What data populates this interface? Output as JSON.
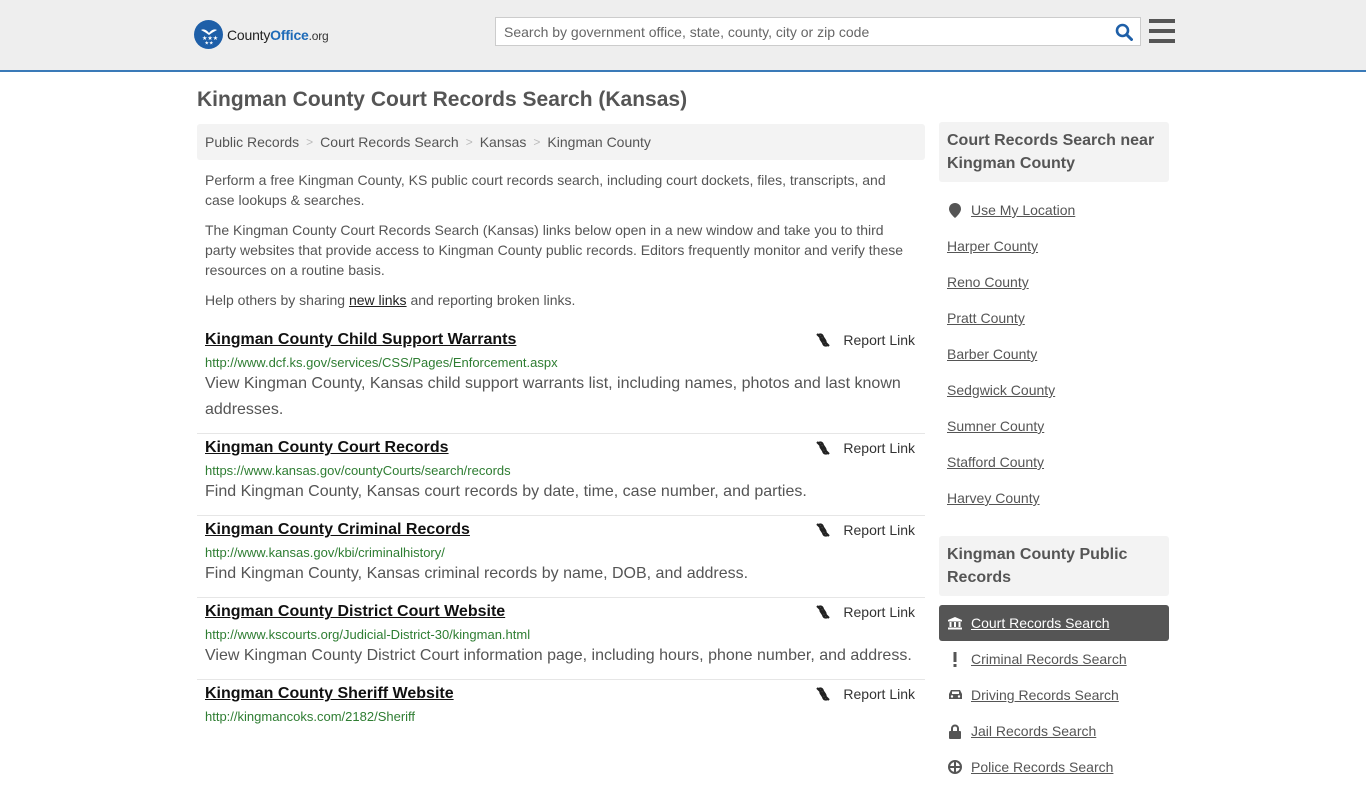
{
  "header": {
    "logo": {
      "text_main": "County",
      "text_bold": "Office",
      "text_suffix": ".org"
    },
    "search": {
      "placeholder": "Search by government office, state, county, city or zip code",
      "value": ""
    },
    "icons": {
      "search": "search-icon",
      "menu": "hamburger-menu-icon"
    }
  },
  "page": {
    "title": "Kingman County Court Records Search (Kansas)",
    "breadcrumb": [
      "Public Records",
      "Court Records Search",
      "Kansas",
      "Kingman County"
    ],
    "intro": {
      "p1": "Perform a free Kingman County, KS public court records search, including court dockets, files, transcripts, and case lookups & searches.",
      "p2": "The Kingman County Court Records Search (Kansas) links below open in a new window and take you to third party websites that provide access to Kingman County public records. Editors frequently monitor and verify these resources on a routine basis.",
      "p3_before": "Help others by sharing ",
      "p3_link": "new links",
      "p3_after": " and reporting broken links."
    }
  },
  "results": [
    {
      "title": "Kingman County Child Support Warrants",
      "url": "http://www.dcf.ks.gov/services/CSS/Pages/Enforcement.aspx",
      "description": "View Kingman County, Kansas child support warrants list, including names, photos and last known addresses.",
      "report_label": "Report Link"
    },
    {
      "title": "Kingman County Court Records",
      "url": "https://www.kansas.gov/countyCourts/search/records",
      "description": "Find Kingman County, Kansas court records by date, time, case number, and parties.",
      "report_label": "Report Link"
    },
    {
      "title": "Kingman County Criminal Records",
      "url": "http://www.kansas.gov/kbi/criminalhistory/",
      "description": "Find Kingman County, Kansas criminal records by name, DOB, and address.",
      "report_label": "Report Link"
    },
    {
      "title": "Kingman County District Court Website",
      "url": "http://www.kscourts.org/Judicial-District-30/kingman.html",
      "description": "View Kingman County District Court information page, including hours, phone number, and address.",
      "report_label": "Report Link"
    },
    {
      "title": "Kingman County Sheriff Website",
      "url": "http://kingmancoks.com/2182/Sheriff",
      "description": "",
      "report_label": "Report Link"
    }
  ],
  "sidebar": {
    "nearby": {
      "heading": "Court Records Search near Kingman County",
      "use_location": "Use My Location",
      "counties": [
        "Harper County",
        "Reno County",
        "Pratt County",
        "Barber County",
        "Sedgwick County",
        "Sumner County",
        "Stafford County",
        "Harvey County"
      ]
    },
    "public_records": {
      "heading": "Kingman County Public Records",
      "items": [
        {
          "label": "Court Records Search",
          "icon": "courthouse-icon",
          "active": true
        },
        {
          "label": "Criminal Records Search",
          "icon": "exclamation-icon",
          "active": false
        },
        {
          "label": "Driving Records Search",
          "icon": "car-icon",
          "active": false
        },
        {
          "label": "Jail Records Search",
          "icon": "lock-icon",
          "active": false
        },
        {
          "label": "Police Records Search",
          "icon": "police-badge-icon",
          "active": false
        }
      ]
    }
  },
  "colors": {
    "accent": "#3a7ab8",
    "logo": "#1e5fa8",
    "url_green": "#2e7d32",
    "active_bg": "#555555"
  }
}
